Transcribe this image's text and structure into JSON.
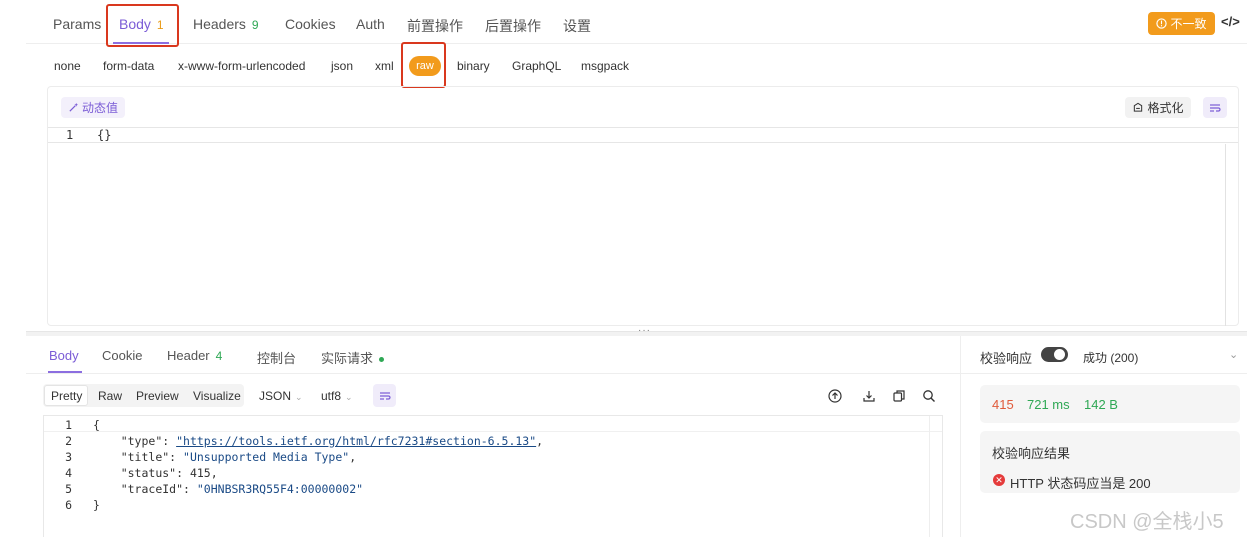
{
  "request_tabs": [
    {
      "label": "Params"
    },
    {
      "label": "Body",
      "count": "1"
    },
    {
      "label": "Headers",
      "count": "9"
    },
    {
      "label": "Cookies"
    },
    {
      "label": "Auth"
    },
    {
      "label": "前置操作"
    },
    {
      "label": "后置操作"
    },
    {
      "label": "设置"
    }
  ],
  "top_right": {
    "inconsistent_icon": "warning-circle-icon",
    "inconsistent_label": "不一致",
    "code_icon": "</>"
  },
  "body_types": [
    "none",
    "form-data",
    "x-www-form-urlencoded",
    "json",
    "xml",
    "raw",
    "binary",
    "GraphQL",
    "msgpack"
  ],
  "selected_body_type": "raw",
  "editor": {
    "dynamic_value_label": "动态值",
    "format_label": "格式化",
    "lines": [
      {
        "num": "1",
        "text": "{}"
      }
    ]
  },
  "response_tabs": [
    {
      "label": "Body"
    },
    {
      "label": "Cookie"
    },
    {
      "label": "Header",
      "count": "4"
    },
    {
      "label": "控制台"
    },
    {
      "label": "实际请求"
    }
  ],
  "view_modes": [
    "Pretty",
    "Raw",
    "Preview",
    "Visualize"
  ],
  "format_select": "JSON",
  "encoding_select": "utf8",
  "response_lines": [
    {
      "num": "1"
    },
    {
      "num": "2"
    },
    {
      "num": "3"
    },
    {
      "num": "4"
    },
    {
      "num": "5"
    },
    {
      "num": "6"
    }
  ],
  "response_json": {
    "type_key": "\"type\"",
    "type_val": "\"https://tools.ietf.org/html/rfc7231#section-6.5.13\"",
    "title_key": "\"title\"",
    "title_val": "\"Unsupported Media Type\"",
    "status_key": "\"status\"",
    "status_val": "415",
    "trace_key": "\"traceId\"",
    "trace_val": "\"0HNBSR3RQ55F4:00000002\""
  },
  "validation": {
    "label": "校验响应",
    "status": "成功 (200)",
    "http_status": "415",
    "time": "721 ms",
    "size": "142 B",
    "result_title": "校验响应结果",
    "result_text": "HTTP 状态码应当是 200"
  },
  "colors": {
    "accent": "#7b5cd6",
    "orange": "#f29b1c",
    "success": "#2fa855",
    "error": "#e53b3b"
  },
  "watermark": "CSDN @全栈小5"
}
